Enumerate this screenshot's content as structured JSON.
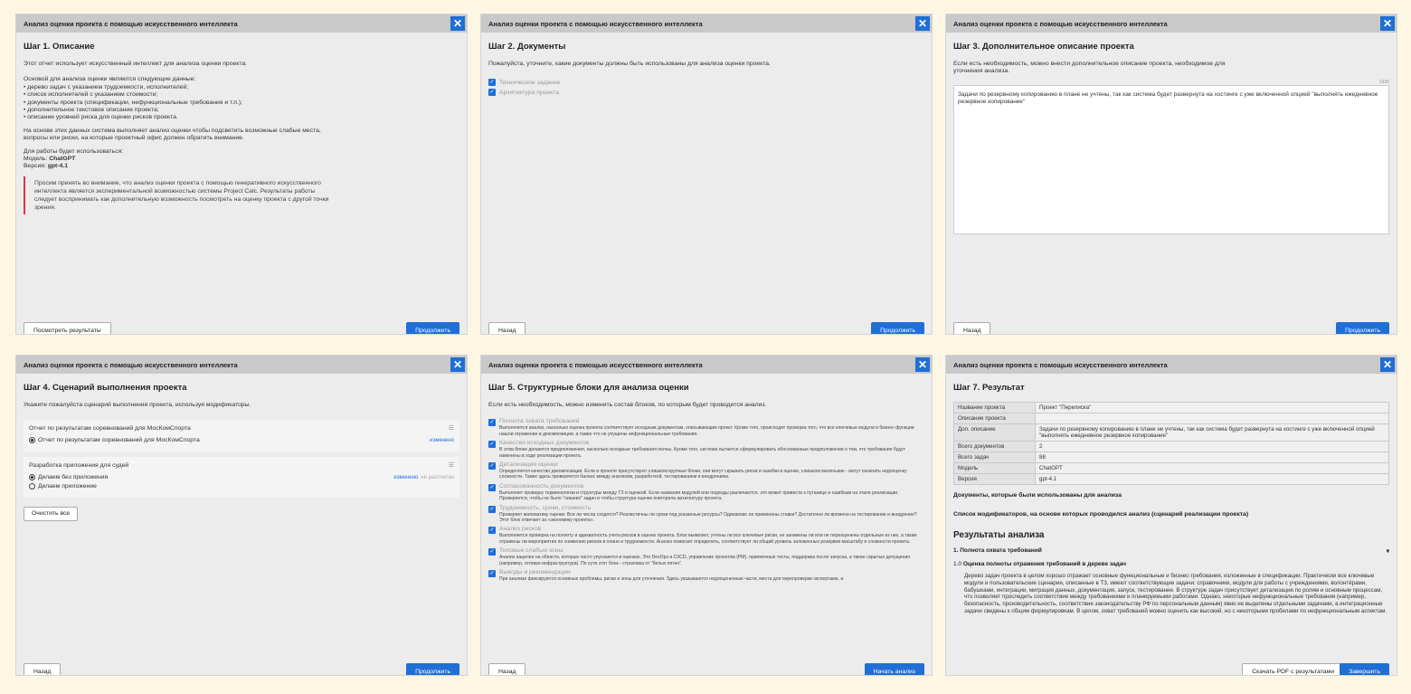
{
  "window_title": "Анализ оценки проекта с помощью искусственного интеллекта",
  "close_glyph": "✕",
  "step1": {
    "heading": "Шаг 1. Описание",
    "intro": "Этот отчет использует искусственный интеллект для анализа оценки проекта.",
    "data_intro": "Основой для анализа оценки являются следующие данные:",
    "items": [
      "дерево задач с указанием трудоемкости, исполнителей;",
      "список исполнителей с указанием стоимости;",
      "документы проекта (спецификации, нефункциональные требования и т.п.);",
      "дополнительное текстовое описание проекта;",
      "описание уровней риска для оценки рисков проекта."
    ],
    "purpose": "На основе этих данных система выполняет анализ оценки чтобы подсветить возможные слабые места, вопросы или риски, на которые проектный офис должен обратить внимание.",
    "use_label": "Для работы будет использоваться:",
    "model_label": "Модель:",
    "model_value": "ChatGPT",
    "version_label": "Версия:",
    "version_value": "gpt-4.1",
    "warning": "Просим принять во внимание, что анализ оценки проекта с помощью генеративного искусственного интеллекта является экспериментальной возможностью системы Project Calc. Результаты работы следует воспринимать как дополнительную возможность посмотреть на оценку проекта с другой точки зрения.",
    "view_results_label": "Посмотреть результаты",
    "continue_label": "Продолжить"
  },
  "step2": {
    "heading": "Шаг 2. Документы",
    "intro": "Пожалуйста, уточните, какие документы должны быть использованы для анализа оценки проекта.",
    "docs": [
      "Техническое задание",
      "Архитектура проекта"
    ],
    "back_label": "Назад",
    "continue_label": "Продолжить"
  },
  "step3": {
    "heading": "Шаг 3. Дополнительное описание проекта",
    "intro": "Если есть необходимость, можно внести дополнительное описание проекта, необходимое для уточнения анализа.",
    "counter": "1935",
    "text": "Задачи по резервному копированию в плане не учтены, так как система будет развернута на хостинге с уже включенной опцией \"выполнять ежедневное резервное копирование\"",
    "back_label": "Назад",
    "continue_label": "Продолжить"
  },
  "step4": {
    "heading": "Шаг 4. Сценарий выполнения проекта",
    "intro": "Укажите пожалуйста сценарий выполнения проекта, используя модификаторы.",
    "scenarios": [
      {
        "title": "Отчет по результатам соревнований для МосКомСпорта",
        "options": [
          "Отчет по результатам соревнований для МосКомСпорта"
        ],
        "changed": "изменено",
        "not_calc": ""
      },
      {
        "title": "Разработка приложения для судей",
        "options": [
          "Делаем без приложения",
          "Делаем приложение"
        ],
        "changed": "изменено",
        "not_calc": "не рассчитан"
      }
    ],
    "clear_label": "Очистить все",
    "back_label": "Назад",
    "continue_label": "Продолжить"
  },
  "step5": {
    "heading": "Шаг 5. Структурные блоки для анализа оценки",
    "intro": "Если есть необходимость, можно изменить состав блоков, по которым будет проводится анализ.",
    "blocks": [
      {
        "title": "Полнота охвата требований",
        "desc": "Выполняется анализ, насколько оценка проекта соответствует исходным документам, описывающим проект. Кроме того, происходит проверка того, что все ключевые модули и бизнес-функции нашли отражение в декомпозиции, а также что не упущены нефункциональные требования."
      },
      {
        "title": "Качество исходных документов",
        "desc": "В этом блоке делаются предположения, насколько исходные требования полны. Кроме того, система пытается сформулировать обоснованные предположения о том, что требования будут изменены в ходе реализации проекта."
      },
      {
        "title": "Детализация оценки",
        "desc": "Определяется качество декомпозиции. Если в проекте присутствуют слишком крупные блоки, они могут скрывать риски и ошибки в оценке, слишком маленькие - могут означать недооценку сложности. Также здесь проверяется баланс между анализом, разработкой, тестированием и внедрением."
      },
      {
        "title": "Согласованность документов",
        "desc": "Выполняет проверку терминологии и структуры между ТЗ и оценкой. Если названия модулей или подходы различаются, это может привести к путанице и ошибкам на этапе реализации. Проверяется, чтобы не было \"лишних\" задач и чтобы структура оценки повторяла архитектуру проекта."
      },
      {
        "title": "Трудоемкость, сроки, стоимость",
        "desc": "Проверяет математику оценки. Все ли числа сходятся? Реалистичны ли сроки под указанные ресурсы? Одинаково ли применены ставки? Достаточно ли времени на тестирование и внедрение? Этот блок отвечает за «экономику проекта»."
      },
      {
        "title": "Анализ рисков",
        "desc": "Выполняется проверка на полноту и адекватность учета рисков в оценке проекта. Блок выявляет, учтены ли все ключевые риски, не занижены ли или не переоценены отдельные из них, а также отражены ли мероприятия по снижению рисков в плане и трудоемкости. Анализ помогает определить, соответствует ли общий уровень заложенных резервов масштабу и сложности проекта."
      },
      {
        "title": "Типовые слабые зоны",
        "desc": "Анализ нацелен на области, которые часто упускаются в оценках. Это DevOps и CI/CD, управление проектом (PM), приемочные тесты, поддержка после запуска, а также скрытые допущения (например, готовая инфраструктура). По сути этот блок - страховка от \"белых пятен\"."
      },
      {
        "title": "Выводы и рекомендации",
        "desc": "При анализе фиксируются основные проблемы, риски и зоны для уточнения. Здесь указываются недооцененные части, места для перепроверки экспертами, а"
      }
    ],
    "back_label": "Назад",
    "start_label": "Начать анализ"
  },
  "step7": {
    "heading": "Шаг 7. Результат",
    "table": [
      {
        "k": "Название проекта",
        "v": "Проект \"Переписка\""
      },
      {
        "k": "Описание проекта",
        "v": ""
      },
      {
        "k": "Доп. описание",
        "v": "Задачи по резервному копированию в плане не учтены, так как система будет развернута на хостинге с уже включенной опцией \"выполнять ежедневное резервное копирование\""
      },
      {
        "k": "Всего документов",
        "v": "2"
      },
      {
        "k": "Всего задач",
        "v": "88"
      },
      {
        "k": "Модель",
        "v": "ChatGPT"
      },
      {
        "k": "Версия",
        "v": "gpt-4.1"
      }
    ],
    "docs_used": "Документы, которые были использованы для анализа",
    "modifiers": "Список модификаторов, на основе которых проводился анализ (сценарий реализации проекта)",
    "results_heading": "Результаты анализа",
    "section1": "1. Полнота охвата требований",
    "subsection": "1.0",
    "subsection_title": "Оценка полноты отражения требований в дереве задач",
    "paragraph": "Дерево задач проекта в целом хорошо отражает основные функциональные и бизнес-требования, изложенные в спецификации. Практически все ключевые модули и пользовательские сценарии, описанные в ТЗ, имеют соответствующие задачи: справочники, модули для работы с учреждениями, волонтёрами, бабушками, интеграции, миграция данных, документация, запуск, тестирование. В структуре задач присутствует детализация по ролям и основным процессам, что позволяет проследить соответствие между требованиями и планируемыми работами. Однако, некоторые нефункциональные требования (например, безопасность, производительность, соответствие законодательству РФ по персональным данным) явно не выделены отдельными задачами, а интеграционные задачи сведены к общим формулировкам. В целом, охват требований можно оценить как высокий, но с некоторыми пробелами по нефункциональным аспектам.",
    "pdf_label": "Скачать PDF с результатами",
    "finish_label": "Завершить"
  }
}
